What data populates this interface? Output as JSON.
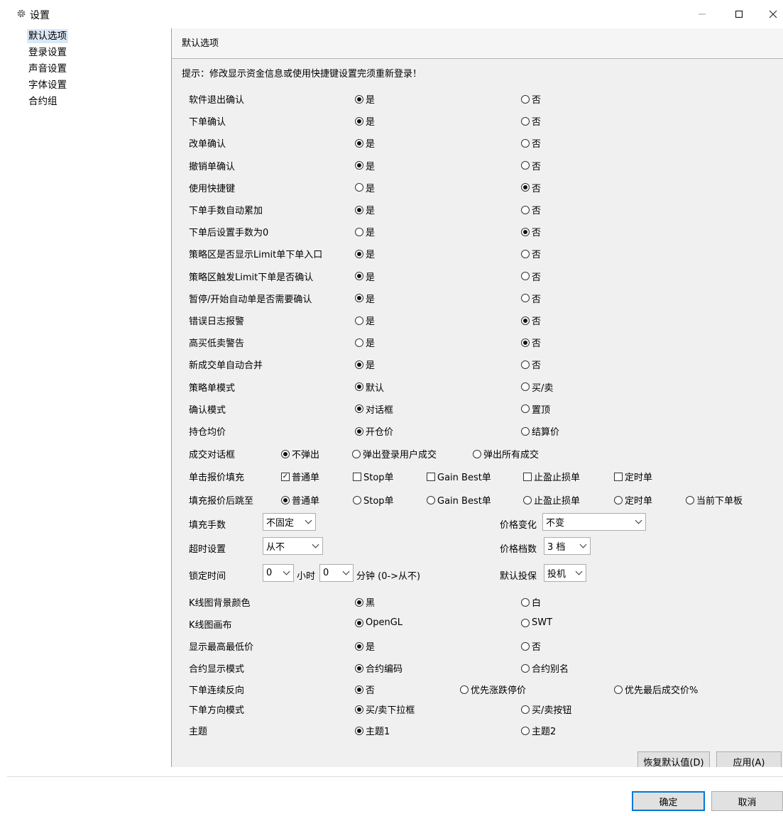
{
  "window": {
    "title": "设置"
  },
  "sidebar": {
    "items": [
      {
        "label": "默认选项",
        "selected": true
      },
      {
        "label": "登录设置"
      },
      {
        "label": "声音设置"
      },
      {
        "label": "字体设置"
      },
      {
        "label": "合约组"
      }
    ]
  },
  "panel": {
    "title": "默认选项",
    "hint": "提示：修改显示资金信息或使用快捷键设置完须重新登录！",
    "rows": [
      {
        "label": "软件退出确认",
        "yes": "是",
        "no": "否",
        "selected": "yes"
      },
      {
        "label": "下单确认",
        "yes": "是",
        "no": "否",
        "selected": "yes"
      },
      {
        "label": "改单确认",
        "yes": "是",
        "no": "否",
        "selected": "yes"
      },
      {
        "label": "撤销单确认",
        "yes": "是",
        "no": "否",
        "selected": "yes"
      },
      {
        "label": "使用快捷键",
        "yes": "是",
        "no": "否",
        "selected": "no"
      },
      {
        "label": "下单手数自动累加",
        "yes": "是",
        "no": "否",
        "selected": "yes"
      },
      {
        "label": "下单后设置手数为0",
        "yes": "是",
        "no": "否",
        "selected": "no"
      },
      {
        "label": "策略区是否显示Limit单下单入口",
        "yes": "是",
        "no": "否",
        "selected": "yes"
      },
      {
        "label": "策略区触发Limit下单是否确认",
        "yes": "是",
        "no": "否",
        "selected": "yes"
      },
      {
        "label": "暂停/开始自动单是否需要确认",
        "yes": "是",
        "no": "否",
        "selected": "yes"
      },
      {
        "label": "错误日志报警",
        "yes": "是",
        "no": "否",
        "selected": "no"
      },
      {
        "label": "高买低卖警告",
        "yes": "是",
        "no": "否",
        "selected": "no"
      },
      {
        "label": "新成交单自动合并",
        "yes": "是",
        "no": "否",
        "selected": "yes"
      },
      {
        "label": "策略单模式",
        "yes": "默认",
        "no": "买/卖",
        "selected": "yes"
      },
      {
        "label": "确认模式",
        "yes": "对话框",
        "no": "置顶",
        "selected": "yes"
      },
      {
        "label": "持仓均价",
        "yes": "开仓价",
        "no": "结算价",
        "selected": "yes"
      }
    ],
    "trade_dialog": {
      "label": "成交对话框",
      "options": [
        "不弹出",
        "弹出登录用户成交",
        "弹出所有成交"
      ],
      "selected": 0
    },
    "click_fill": {
      "label": "单击报价填充",
      "options": [
        "普通单",
        "Stop单",
        "Gain Best单",
        "止盈止损单",
        "定时单"
      ],
      "checked": [
        true,
        false,
        false,
        false,
        false
      ]
    },
    "jump_after_fill": {
      "label": "填充报价后跳至",
      "options": [
        "普通单",
        "Stop单",
        "Gain Best单",
        "止盈止损单",
        "定时单",
        "当前下单板"
      ],
      "selected": 0
    },
    "fill_qty": {
      "label": "填充手数",
      "value": "不固定"
    },
    "price_change": {
      "label": "价格变化",
      "value": "不变"
    },
    "timeout": {
      "label": "超时设置",
      "value": "从不"
    },
    "price_levels": {
      "label": "价格档数",
      "value": "3 档"
    },
    "lock_time": {
      "label": "锁定时间",
      "hours": "0",
      "hours_unit": "小时",
      "minutes": "0",
      "minutes_unit": "分钟 (0->从不)"
    },
    "default_hedge": {
      "label": "默认投保",
      "value": "投机"
    },
    "rows2": [
      {
        "label": "K线图背景颜色",
        "a": "黑",
        "b": "白",
        "selected": "a"
      },
      {
        "label": "K线图画布",
        "a": "OpenGL",
        "b": "SWT",
        "selected": "a"
      },
      {
        "label": "显示最高最低价",
        "a": "是",
        "b": "否",
        "selected": "a"
      },
      {
        "label": "合约显示模式",
        "a": "合约编码",
        "b": "合约别名",
        "selected": "a"
      }
    ],
    "reverse": {
      "label": "下单连续反向",
      "options": [
        "否",
        "优先涨跌停价",
        "优先最后成交价%"
      ],
      "selected": 0
    },
    "rows3": [
      {
        "label": "下单方向模式",
        "a": "买/卖下拉框",
        "b": "买/卖按钮",
        "selected": "a"
      },
      {
        "label": "主题",
        "a": "主题1",
        "b": "主题2",
        "selected": "a"
      }
    ],
    "restore_label": "恢复默认值(D)",
    "apply_label": "应用(A)"
  },
  "footer": {
    "ok_label": "确定",
    "cancel_label": "取消"
  },
  "icons": {
    "app": "gear-icon",
    "minimize": "minimize-icon",
    "maximize": "maximize-icon",
    "close": "close-icon"
  }
}
